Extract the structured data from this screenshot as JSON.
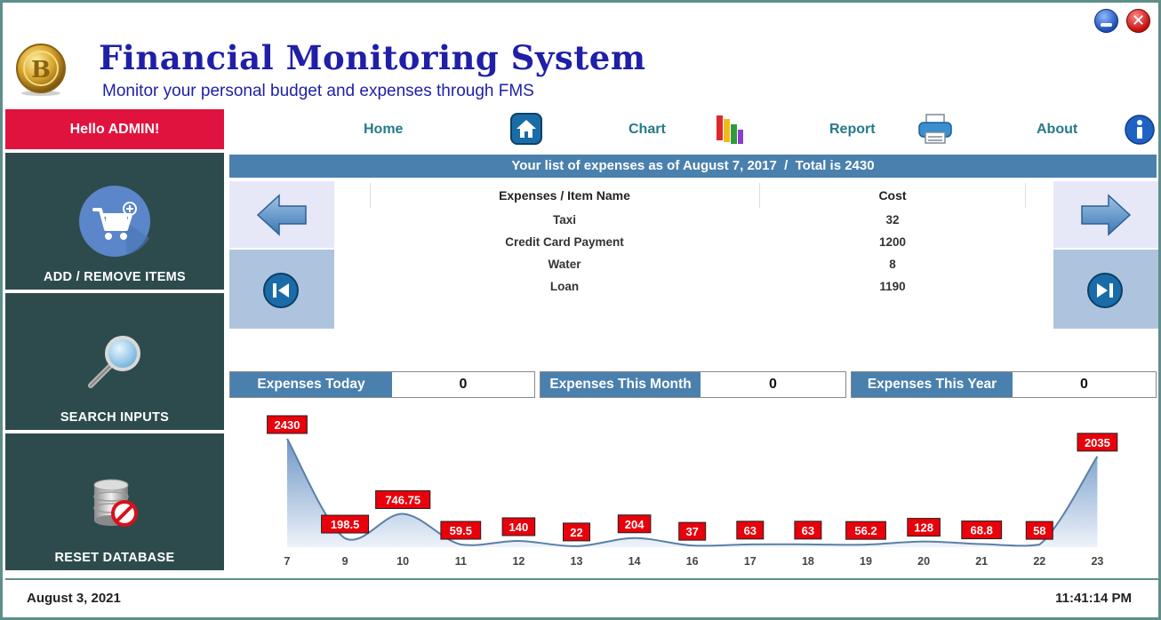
{
  "header": {
    "title": "Financial Monitoring System",
    "subtitle": "Monitor your personal budget and expenses through FMS"
  },
  "window_controls": {
    "close_glyph": "✕"
  },
  "sidebar": {
    "greeting": "Hello ADMIN!",
    "items": [
      {
        "label": "ADD / REMOVE ITEMS",
        "icon": "cart-add-icon"
      },
      {
        "label": "SEARCH INPUTS",
        "icon": "magnifier-icon"
      },
      {
        "label": "RESET DATABASE",
        "icon": "database-reset-icon"
      }
    ]
  },
  "nav": {
    "items": [
      {
        "label": "Home",
        "icon": "home-icon"
      },
      {
        "label": "Chart",
        "icon": "bar-chart-icon"
      },
      {
        "label": "Report",
        "icon": "printer-icon"
      },
      {
        "label": "About",
        "icon": "info-icon"
      }
    ]
  },
  "expenses": {
    "header": "Your list of expenses as of August 7, 2017  /  Total is 2430",
    "columns": [
      "Expenses / Item Name",
      "Cost"
    ],
    "rows": [
      {
        "name": "Taxi",
        "cost": "32"
      },
      {
        "name": "Credit Card Payment",
        "cost": "1200"
      },
      {
        "name": "Water",
        "cost": "8"
      },
      {
        "name": "Loan",
        "cost": "1190"
      }
    ]
  },
  "summary": {
    "today_label": "Expenses Today",
    "today_value": "0",
    "month_label": "Expenses This Month",
    "month_value": "0",
    "year_label": "Expenses This Year",
    "year_value": "0"
  },
  "chart_data": {
    "type": "area",
    "x": [
      "7",
      "9",
      "10",
      "11",
      "12",
      "13",
      "14",
      "16",
      "17",
      "18",
      "19",
      "20",
      "21",
      "22",
      "23"
    ],
    "values": [
      2430,
      198.5,
      746.75,
      59.5,
      140,
      22,
      204,
      37,
      63,
      63,
      56.2,
      128,
      68.8,
      58,
      2035
    ],
    "labels": [
      "2430",
      "198.5",
      "746.75",
      "59.5",
      "140",
      "22",
      "204",
      "37",
      "63",
      "63",
      "56.2",
      "128",
      "68.8",
      "58",
      "2035"
    ],
    "title": "",
    "xlabel": "",
    "ylabel": "",
    "ylim": [
      0,
      2430
    ],
    "grid": false,
    "colors": {
      "fill_top": "#6f97c6",
      "fill_bottom": "#eef3fa",
      "line": "#5a7fa8",
      "label_bg": "#e8000b"
    }
  },
  "footer": {
    "date": "August 3, 2021",
    "time": "11:41:14 PM"
  },
  "colors": {
    "accent": "#4a80ad",
    "sidebar_bg": "#2d4b4d",
    "greeting_bg": "#e0133f",
    "title": "#1f1fa8",
    "nav_text": "#257a8a"
  }
}
